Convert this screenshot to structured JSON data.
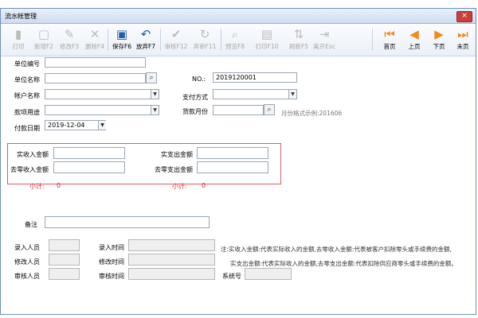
{
  "window": {
    "title": "流水帐管理",
    "close_glyph": "×"
  },
  "toolbar": {
    "print": "打印",
    "new": "新增F2",
    "edit": "修改F3",
    "delete": "删除F4",
    "save": "保存F6",
    "discard": "放弃F7",
    "audit": "审核F12",
    "unaudit": "弃审F11",
    "preview": "预览F8",
    "printf10": "打印F10",
    "refresh": "刷新F5",
    "exit": "离开Esc",
    "first": "首页",
    "prev": "上页",
    "next": "下页",
    "last": "末页"
  },
  "form": {
    "unit_code_label": "单位编号",
    "unit_name_label": "单位名称",
    "no_label": "NO.:",
    "no_value": "2019120001",
    "account_label": "帐户名称",
    "paymethod_label": "支付方式",
    "purpose_label": "款项用途",
    "month_label": "货款月份",
    "month_hint": "月份格式示例:201606",
    "date_label": "付款日期",
    "date_value": "2019-12-04"
  },
  "amounts": {
    "income_label": "实收入金额",
    "expense_label": "实支出金额",
    "income_round_label": "去零收入金额",
    "expense_round_label": "去零支出金额",
    "subtotal_label1": "小计:",
    "subtotal_value1": "0",
    "subtotal_label2": "小计:",
    "subtotal_value2": "0"
  },
  "remark": {
    "label": "备注"
  },
  "footer": {
    "entry_person": "录入人员",
    "entry_time": "录入时间",
    "modify_person": "修改人员",
    "modify_time": "修改时间",
    "audit_person": "审核人员",
    "audit_time": "审核时间",
    "system_no": "系统号",
    "note1": "注:实收入金额:代表实际收入的金额,去零收入金额:代表被客户扣除零头或手续费的金额,",
    "note2": "实支出金额:代表实际收入的金额,去零支出金额:代表扣除供应商零头或手续费的金额。"
  },
  "colors": {
    "accent": "#e1262c",
    "frame": "#6f8fb8",
    "nav": "#f08a1c"
  }
}
